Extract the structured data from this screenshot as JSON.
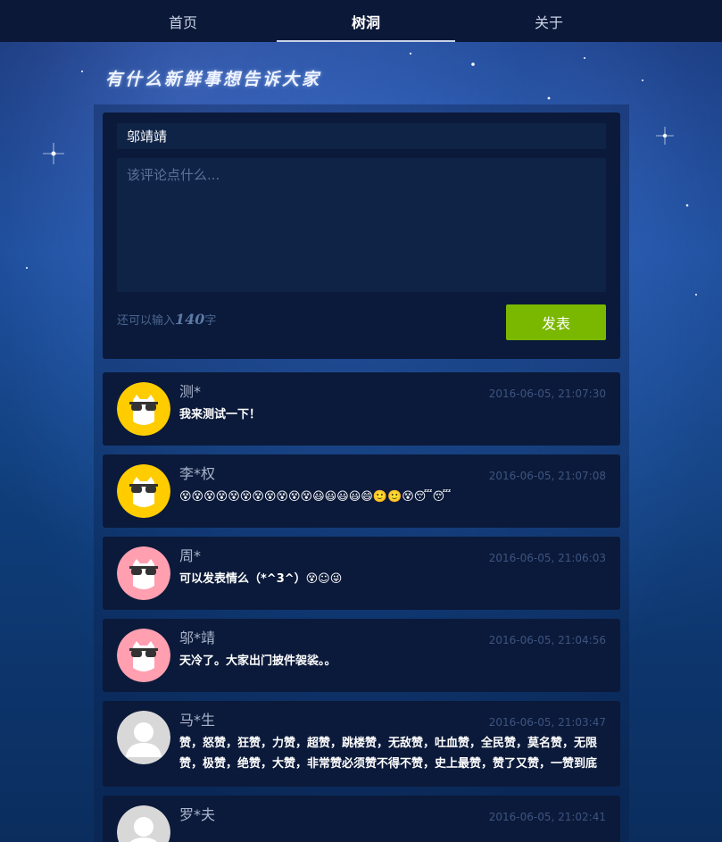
{
  "nav": {
    "items": [
      {
        "label": "首页",
        "active": false
      },
      {
        "label": "树洞",
        "active": true
      },
      {
        "label": "关于",
        "active": false
      }
    ]
  },
  "slogan": "有什么新鲜事想告诉大家",
  "composer": {
    "name_value": "邬靖靖",
    "comment_placeholder": "该评论点什么...",
    "counter_prefix": "还可以输入",
    "counter_num": "140",
    "counter_suffix": "字",
    "submit_label": "发表"
  },
  "colors": {
    "accent": "#7ab800",
    "avatar_yellow": "#ffcc00",
    "avatar_pink": "#ff9fb0",
    "avatar_gray": "#d8d8d8"
  },
  "posts": [
    {
      "author": "测*",
      "time": "2016-06-05, 21:07:30",
      "content": "我来测试一下！",
      "avatar": "yellow-sunglasses"
    },
    {
      "author": "李*权",
      "time": "2016-06-05, 21:07:08",
      "content": "😵😵😵😵😵😵😵😵😵😵😵😃😃😃😃😄🙂🙂😵😴😴",
      "avatar": "yellow-sunglasses"
    },
    {
      "author": "周*",
      "time": "2016-06-05, 21:06:03",
      "content": "可以发表情么（*^3^）😵☺😜",
      "avatar": "pink-sunglasses"
    },
    {
      "author": "邬*靖",
      "time": "2016-06-05, 21:04:56",
      "content": "天冷了。大家出门披件袈裟。。",
      "avatar": "pink-sunglasses"
    },
    {
      "author": "马*生",
      "time": "2016-06-05, 21:03:47",
      "content": "赞，怒赞，狂赞，力赞，超赞，跳楼赞，无敌赞，吐血赞，全民赞，莫名赞，无限赞，极赞，绝赞，大赞，非常赞必须赞不得不赞，史上最赞，赞了又赞，一赞到底",
      "avatar": "gray-person"
    },
    {
      "author": "罗*夫",
      "time": "2016-06-05, 21:02:41",
      "content": "",
      "avatar": "gray-person"
    }
  ]
}
